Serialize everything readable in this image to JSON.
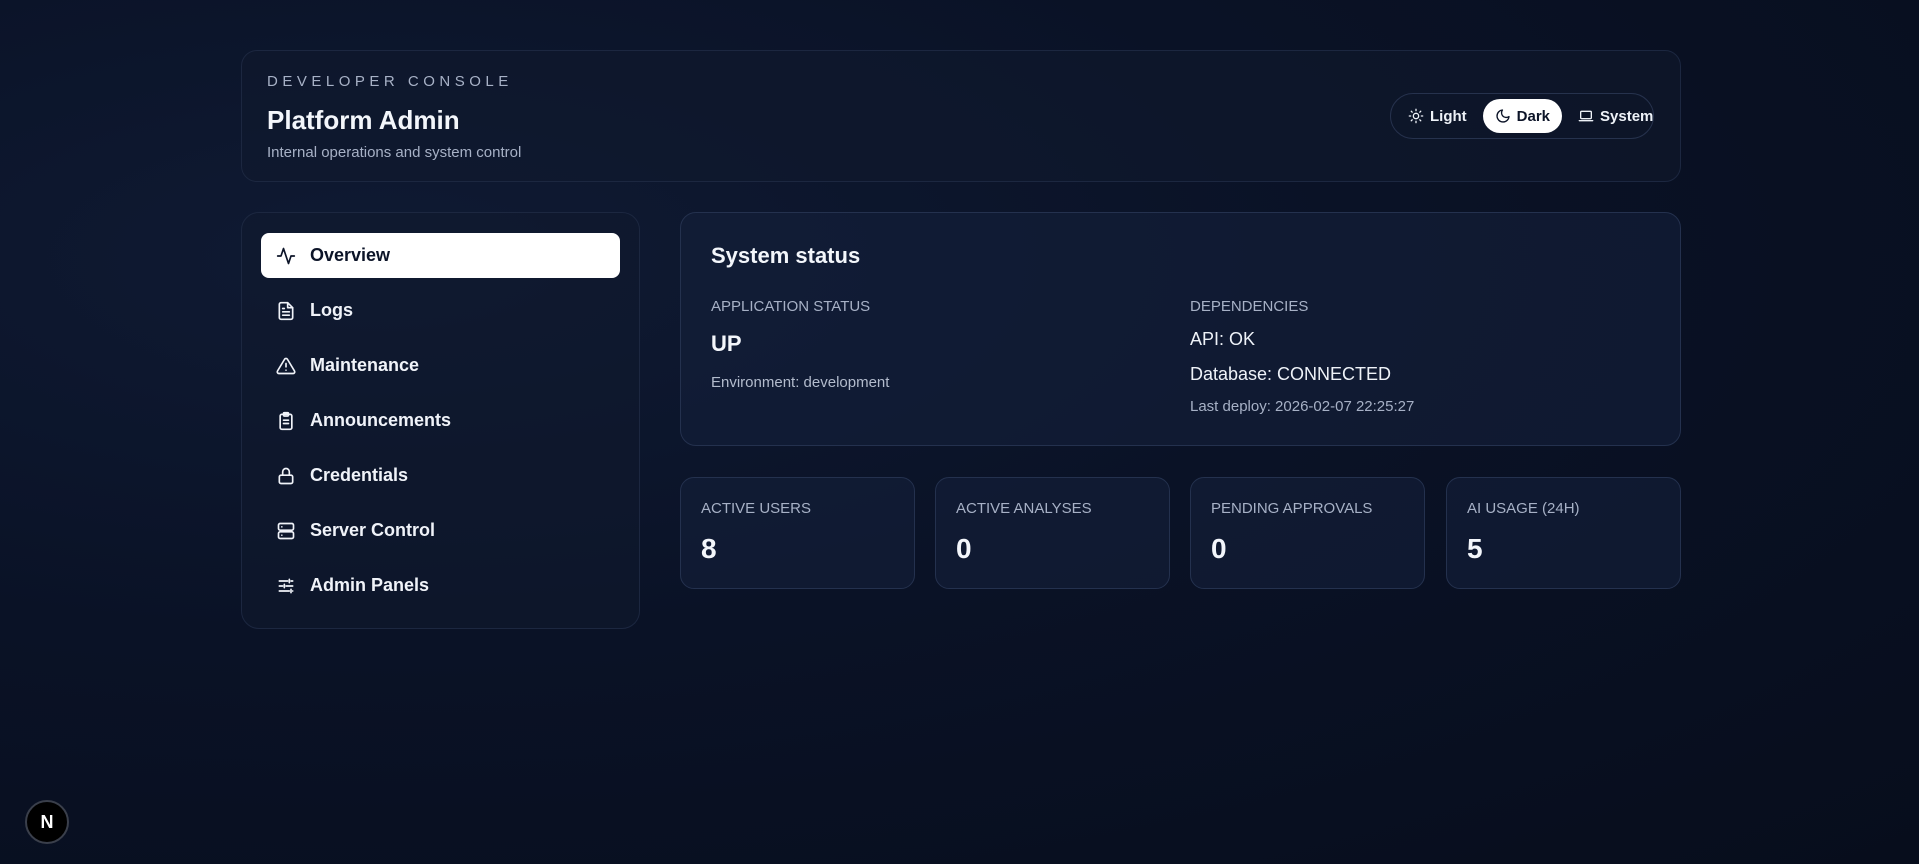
{
  "header": {
    "eyebrow": "DEVELOPER CONSOLE",
    "title": "Platform Admin",
    "subtitle": "Internal operations and system control"
  },
  "theme_toggle": {
    "options": [
      {
        "label": "Light",
        "icon": "sun-icon"
      },
      {
        "label": "Dark",
        "icon": "moon-icon",
        "active": true
      },
      {
        "label": "System",
        "icon": "laptop-icon"
      }
    ]
  },
  "sidebar": {
    "items": [
      {
        "label": "Overview",
        "icon": "activity-icon",
        "active": true
      },
      {
        "label": "Logs",
        "icon": "file-text-icon"
      },
      {
        "label": "Maintenance",
        "icon": "alert-triangle-icon"
      },
      {
        "label": "Announcements",
        "icon": "clipboard-icon"
      },
      {
        "label": "Credentials",
        "icon": "lock-icon"
      },
      {
        "label": "Server Control",
        "icon": "server-icon"
      },
      {
        "label": "Admin Panels",
        "icon": "sliders-icon"
      }
    ]
  },
  "status": {
    "title": "System status",
    "app_label": "APPLICATION STATUS",
    "app_value": "UP",
    "environment": "Environment: development",
    "deps_label": "DEPENDENCIES",
    "api": "API: OK",
    "database": "Database: CONNECTED",
    "last_deploy": "Last deploy: 2026-02-07 22:25:27"
  },
  "metrics": [
    {
      "label": "ACTIVE USERS",
      "value": "8"
    },
    {
      "label": "ACTIVE ANALYSES",
      "value": "0"
    },
    {
      "label": "PENDING APPROVALS",
      "value": "0"
    },
    {
      "label": "AI USAGE (24H)",
      "value": "5"
    }
  ],
  "badge": {
    "letter": "N"
  },
  "colors": {
    "background": "#0a1226",
    "card_border": "#1c2740",
    "active_bg": "#ffffff",
    "muted_text": "#a7b1c6"
  }
}
